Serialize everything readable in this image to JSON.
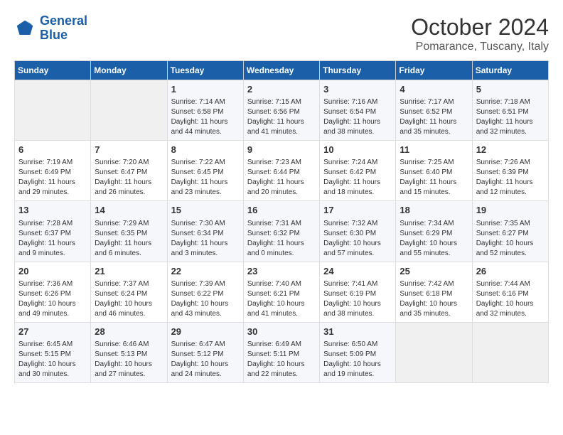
{
  "logo": {
    "text_general": "General",
    "text_blue": "Blue"
  },
  "header": {
    "month_year": "October 2024",
    "location": "Pomarance, Tuscany, Italy"
  },
  "weekdays": [
    "Sunday",
    "Monday",
    "Tuesday",
    "Wednesday",
    "Thursday",
    "Friday",
    "Saturday"
  ],
  "weeks": [
    [
      {
        "day": "",
        "empty": true
      },
      {
        "day": "",
        "empty": true
      },
      {
        "day": "1",
        "sunrise": "7:14 AM",
        "sunset": "6:58 PM",
        "daylight": "11 hours and 44 minutes."
      },
      {
        "day": "2",
        "sunrise": "7:15 AM",
        "sunset": "6:56 PM",
        "daylight": "11 hours and 41 minutes."
      },
      {
        "day": "3",
        "sunrise": "7:16 AM",
        "sunset": "6:54 PM",
        "daylight": "11 hours and 38 minutes."
      },
      {
        "day": "4",
        "sunrise": "7:17 AM",
        "sunset": "6:52 PM",
        "daylight": "11 hours and 35 minutes."
      },
      {
        "day": "5",
        "sunrise": "7:18 AM",
        "sunset": "6:51 PM",
        "daylight": "11 hours and 32 minutes."
      }
    ],
    [
      {
        "day": "6",
        "sunrise": "7:19 AM",
        "sunset": "6:49 PM",
        "daylight": "11 hours and 29 minutes."
      },
      {
        "day": "7",
        "sunrise": "7:20 AM",
        "sunset": "6:47 PM",
        "daylight": "11 hours and 26 minutes."
      },
      {
        "day": "8",
        "sunrise": "7:22 AM",
        "sunset": "6:45 PM",
        "daylight": "11 hours and 23 minutes."
      },
      {
        "day": "9",
        "sunrise": "7:23 AM",
        "sunset": "6:44 PM",
        "daylight": "11 hours and 20 minutes."
      },
      {
        "day": "10",
        "sunrise": "7:24 AM",
        "sunset": "6:42 PM",
        "daylight": "11 hours and 18 minutes."
      },
      {
        "day": "11",
        "sunrise": "7:25 AM",
        "sunset": "6:40 PM",
        "daylight": "11 hours and 15 minutes."
      },
      {
        "day": "12",
        "sunrise": "7:26 AM",
        "sunset": "6:39 PM",
        "daylight": "11 hours and 12 minutes."
      }
    ],
    [
      {
        "day": "13",
        "sunrise": "7:28 AM",
        "sunset": "6:37 PM",
        "daylight": "11 hours and 9 minutes."
      },
      {
        "day": "14",
        "sunrise": "7:29 AM",
        "sunset": "6:35 PM",
        "daylight": "11 hours and 6 minutes."
      },
      {
        "day": "15",
        "sunrise": "7:30 AM",
        "sunset": "6:34 PM",
        "daylight": "11 hours and 3 minutes."
      },
      {
        "day": "16",
        "sunrise": "7:31 AM",
        "sunset": "6:32 PM",
        "daylight": "11 hours and 0 minutes."
      },
      {
        "day": "17",
        "sunrise": "7:32 AM",
        "sunset": "6:30 PM",
        "daylight": "10 hours and 57 minutes."
      },
      {
        "day": "18",
        "sunrise": "7:34 AM",
        "sunset": "6:29 PM",
        "daylight": "10 hours and 55 minutes."
      },
      {
        "day": "19",
        "sunrise": "7:35 AM",
        "sunset": "6:27 PM",
        "daylight": "10 hours and 52 minutes."
      }
    ],
    [
      {
        "day": "20",
        "sunrise": "7:36 AM",
        "sunset": "6:26 PM",
        "daylight": "10 hours and 49 minutes."
      },
      {
        "day": "21",
        "sunrise": "7:37 AM",
        "sunset": "6:24 PM",
        "daylight": "10 hours and 46 minutes."
      },
      {
        "day": "22",
        "sunrise": "7:39 AM",
        "sunset": "6:22 PM",
        "daylight": "10 hours and 43 minutes."
      },
      {
        "day": "23",
        "sunrise": "7:40 AM",
        "sunset": "6:21 PM",
        "daylight": "10 hours and 41 minutes."
      },
      {
        "day": "24",
        "sunrise": "7:41 AM",
        "sunset": "6:19 PM",
        "daylight": "10 hours and 38 minutes."
      },
      {
        "day": "25",
        "sunrise": "7:42 AM",
        "sunset": "6:18 PM",
        "daylight": "10 hours and 35 minutes."
      },
      {
        "day": "26",
        "sunrise": "7:44 AM",
        "sunset": "6:16 PM",
        "daylight": "10 hours and 32 minutes."
      }
    ],
    [
      {
        "day": "27",
        "sunrise": "6:45 AM",
        "sunset": "5:15 PM",
        "daylight": "10 hours and 30 minutes."
      },
      {
        "day": "28",
        "sunrise": "6:46 AM",
        "sunset": "5:13 PM",
        "daylight": "10 hours and 27 minutes."
      },
      {
        "day": "29",
        "sunrise": "6:47 AM",
        "sunset": "5:12 PM",
        "daylight": "10 hours and 24 minutes."
      },
      {
        "day": "30",
        "sunrise": "6:49 AM",
        "sunset": "5:11 PM",
        "daylight": "10 hours and 22 minutes."
      },
      {
        "day": "31",
        "sunrise": "6:50 AM",
        "sunset": "5:09 PM",
        "daylight": "10 hours and 19 minutes."
      },
      {
        "day": "",
        "empty": true
      },
      {
        "day": "",
        "empty": true
      }
    ]
  ]
}
